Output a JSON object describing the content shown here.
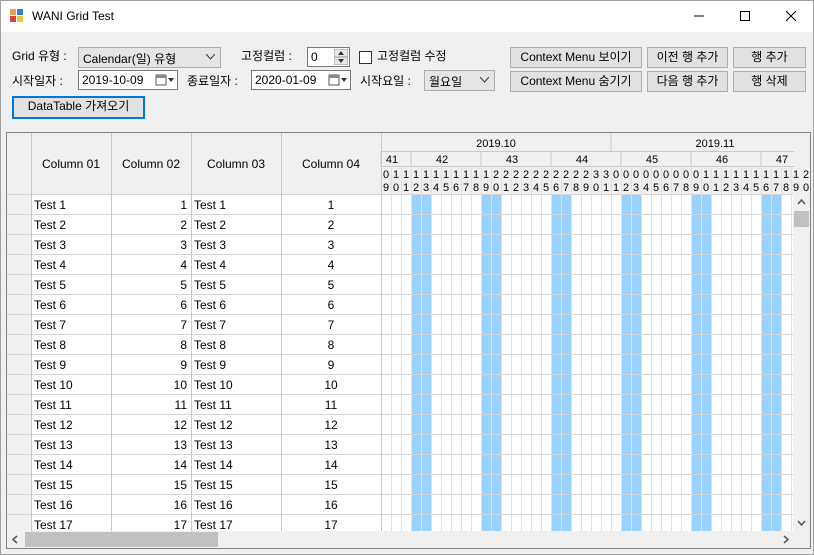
{
  "window": {
    "title": "WANI Grid Test"
  },
  "controls": {
    "grid_type_label": "Grid 유형 :",
    "grid_type_value": "Calendar(일) 유형",
    "fixed_col_label": "고정컬럼 :",
    "fixed_col_value": "0",
    "fixed_col_edit_label": "고정컬럼 수정",
    "start_date_label": "시작일자 :",
    "start_date_value": "2019-10-09",
    "end_date_label": "종료일자 :",
    "end_date_value": "2020-01-09",
    "start_weekday_label": "시작요일 :",
    "start_weekday_value": "월요일",
    "datatable_button": "DataTable 가져오기"
  },
  "buttons": {
    "context_show": "Context Menu 보이기",
    "context_hide": "Context Menu 숨기기",
    "prev_row_add": "이전 행 추가",
    "next_row_add": "다음 행 추가",
    "row_add": "행 추가",
    "row_delete": "행 삭제"
  },
  "grid": {
    "columns": [
      "Column 01",
      "Column 02",
      "Column 03",
      "Column 04"
    ],
    "months": [
      "2019.10",
      "2019.11"
    ],
    "weeks": [
      "41",
      "42",
      "43",
      "44",
      "45",
      "46",
      "47"
    ],
    "day_tens": [
      "0",
      "1",
      "1",
      "1",
      "1",
      "1",
      "1",
      "1",
      "1",
      "1",
      "1",
      "2",
      "2",
      "2",
      "2",
      "2",
      "2",
      "2",
      "2",
      "2",
      "2",
      "3",
      "3",
      "0",
      "0",
      "0",
      "0",
      "0",
      "0",
      "0",
      "0",
      "0",
      "1",
      "1",
      "1",
      "1",
      "1",
      "1",
      "1",
      "1",
      "1",
      "1",
      "2"
    ],
    "day_ones": [
      "9",
      "0",
      "1",
      "2",
      "3",
      "4",
      "5",
      "6",
      "7",
      "8",
      "9",
      "0",
      "1",
      "2",
      "3",
      "4",
      "5",
      "6",
      "7",
      "8",
      "9",
      "0",
      "1",
      "1",
      "2",
      "3",
      "4",
      "5",
      "6",
      "7",
      "8",
      "9",
      "0",
      "1",
      "2",
      "3",
      "4",
      "5",
      "6",
      "7",
      "8",
      "9",
      "0"
    ],
    "rows": [
      [
        "Test 1",
        "1",
        "Test 1",
        "1"
      ],
      [
        "Test 2",
        "2",
        "Test 2",
        "2"
      ],
      [
        "Test 3",
        "3",
        "Test 3",
        "3"
      ],
      [
        "Test 4",
        "4",
        "Test 4",
        "4"
      ],
      [
        "Test 5",
        "5",
        "Test 5",
        "5"
      ],
      [
        "Test 6",
        "6",
        "Test 6",
        "6"
      ],
      [
        "Test 7",
        "7",
        "Test 7",
        "7"
      ],
      [
        "Test 8",
        "8",
        "Test 8",
        "8"
      ],
      [
        "Test 9",
        "9",
        "Test 9",
        "9"
      ],
      [
        "Test 10",
        "10",
        "Test 10",
        "10"
      ],
      [
        "Test 11",
        "11",
        "Test 11",
        "11"
      ],
      [
        "Test 12",
        "12",
        "Test 12",
        "12"
      ],
      [
        "Test 13",
        "13",
        "Test 13",
        "13"
      ],
      [
        "Test 14",
        "14",
        "Test 14",
        "14"
      ],
      [
        "Test 15",
        "15",
        "Test 15",
        "15"
      ],
      [
        "Test 16",
        "16",
        "Test 16",
        "16"
      ],
      [
        "Test 17",
        "17",
        "Test 17",
        "17"
      ]
    ],
    "weekend_color": "#99d1ff"
  }
}
